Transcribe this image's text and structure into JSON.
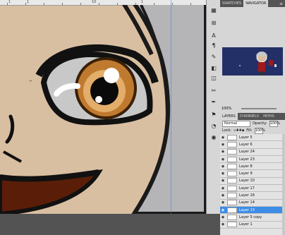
{
  "ruler": {
    "label_a": "1",
    "label_b": "1",
    "label_c": "10",
    "label_d": "1"
  },
  "panels": {
    "navigator": {
      "tabs": [
        "SWATCHES",
        "NAVIGATOR"
      ],
      "zoom": "100%"
    },
    "layers": {
      "tabs": [
        "LAYERS",
        "CHANNELS",
        "PATHS"
      ],
      "blend_mode": "Normal",
      "opacity_label": "Opacity:",
      "opacity_value": "100%",
      "lock_label": "Lock:",
      "fill_label": "Fill:",
      "fill_value": "100%",
      "rows": [
        {
          "name": "Layer 5",
          "selected": false
        },
        {
          "name": "Layer 6",
          "selected": false
        },
        {
          "name": "Layer 24",
          "selected": false
        },
        {
          "name": "Layer 23",
          "selected": false
        },
        {
          "name": "Layer 8",
          "selected": false
        },
        {
          "name": "Layer 9",
          "selected": false
        },
        {
          "name": "Layer 10",
          "selected": false
        },
        {
          "name": "Layer 17",
          "selected": false
        },
        {
          "name": "Layer 16",
          "selected": false
        },
        {
          "name": "Layer 14",
          "selected": false
        },
        {
          "name": "Layer 13",
          "selected": true
        },
        {
          "name": "Layer 5 copy",
          "selected": false
        },
        {
          "name": "Layer 1",
          "selected": false
        }
      ]
    }
  },
  "tools": [
    "layers-tool-icon",
    "grid-icon",
    "move-icon",
    "lasso-icon",
    "brush-icon",
    "stamp-icon",
    "eraser-icon",
    "shape-icon",
    "crop-icon",
    "pen-icon",
    "text-icon",
    "clock-icon",
    "zoom-icon"
  ]
}
